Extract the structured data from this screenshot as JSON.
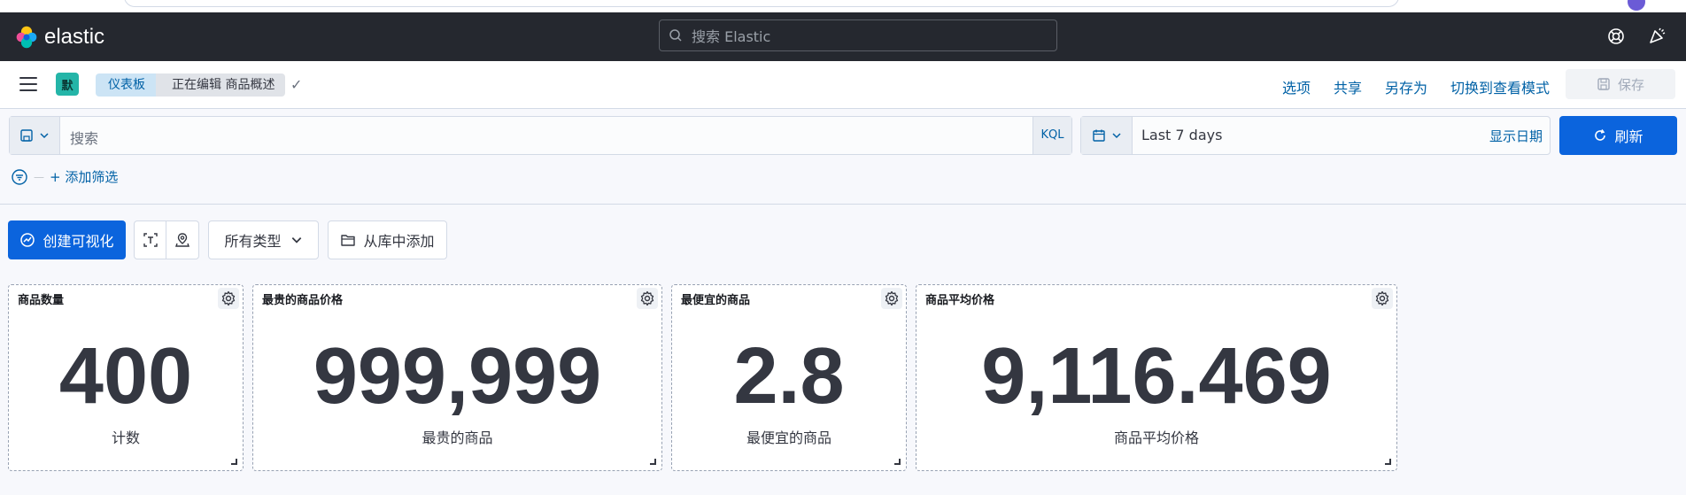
{
  "header": {
    "brand": "elastic",
    "search_placeholder": "搜索 Elastic"
  },
  "toolbar": {
    "space_initial": "默",
    "breadcrumbs": [
      "仪表板",
      "正在编辑 商品概述"
    ],
    "links": [
      "选项",
      "共享",
      "另存为",
      "切换到查看模式"
    ],
    "save_label": "保存"
  },
  "query": {
    "placeholder": "搜索",
    "language": "KQL",
    "time_range": "Last 7 days",
    "show_dates": "显示日期",
    "refresh_label": "刷新",
    "add_filter": "+ 添加筛选"
  },
  "panel_toolbar": {
    "create_label": "创建可视化",
    "types_label": "所有类型",
    "library_label": "从库中添加"
  },
  "panels": [
    {
      "title": "商品数量",
      "value": "400",
      "label": "计数"
    },
    {
      "title": "最贵的商品价格",
      "value": "999,999",
      "label": "最贵的商品"
    },
    {
      "title": "最便宜的商品",
      "value": "2.8",
      "label": "最便宜的商品"
    },
    {
      "title": "商品平均价格",
      "value": "9,116.469",
      "label": "商品平均价格"
    }
  ],
  "colors": {
    "header_bg": "#25282f",
    "primary": "#0b64dd",
    "link": "#0061a6",
    "space_badge": "#24b5a8"
  },
  "icons": [
    "elastic-logo",
    "search-icon",
    "help-icon",
    "newsfeed-icon",
    "menu-icon",
    "check-icon",
    "save-icon",
    "calendar-icon",
    "refresh-icon",
    "filter-icon",
    "create-icon",
    "text-icon",
    "map-icon",
    "chevron-down-icon",
    "folder-icon",
    "gear-icon",
    "resize-icon"
  ]
}
